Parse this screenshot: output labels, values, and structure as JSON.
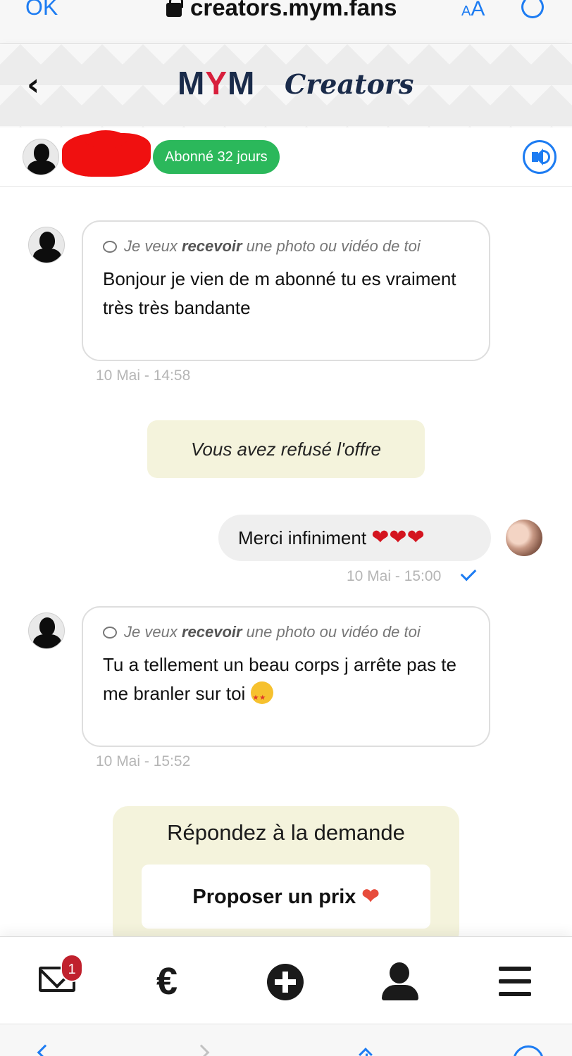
{
  "browser": {
    "done_label": "OK",
    "url": "creators.mym.fans",
    "text_size_small": "A",
    "text_size_large": "A"
  },
  "brand": {
    "logo_main_prefix": "M",
    "logo_main_y": "Y",
    "logo_main_suffix": "M",
    "logo_sub": "Creators"
  },
  "conversation": {
    "subscription_badge": "Abonné 32 jours"
  },
  "messages": [
    {
      "request_prefix": "Je veux ",
      "request_bold": "recevoir",
      "request_suffix": " une photo ou vidéo de toi",
      "text": "Bonjour je vien de m abonné tu es vraiment très très bandante",
      "timestamp": "10 Mai - 14:58"
    },
    {
      "system_note": "Vous avez refusé l'offre"
    },
    {
      "text": "Merci infiniment",
      "hearts": "❤❤❤",
      "timestamp": "10 Mai - 15:00"
    },
    {
      "request_prefix": "Je veux ",
      "request_bold": "recevoir",
      "request_suffix": " une photo ou vidéo de toi",
      "text": "Tu a tellement un beau corps j arrête pas te me branler sur toi",
      "timestamp": "10 Mai - 15:52"
    }
  ],
  "request_card": {
    "title": "Répondez à la demande",
    "button_label": "Proposer un prix",
    "button_heart": "❤"
  },
  "bottom_nav": {
    "messages_badge": "1",
    "wallet_symbol": "€"
  },
  "colors": {
    "accent_blue": "#1d7cf2",
    "subscription_green": "#2bb85b",
    "brand_navy": "#1a2b4a",
    "brand_red": "#d81f3c",
    "system_note_bg": "#f4f3dc",
    "badge_red": "#c0212d"
  }
}
